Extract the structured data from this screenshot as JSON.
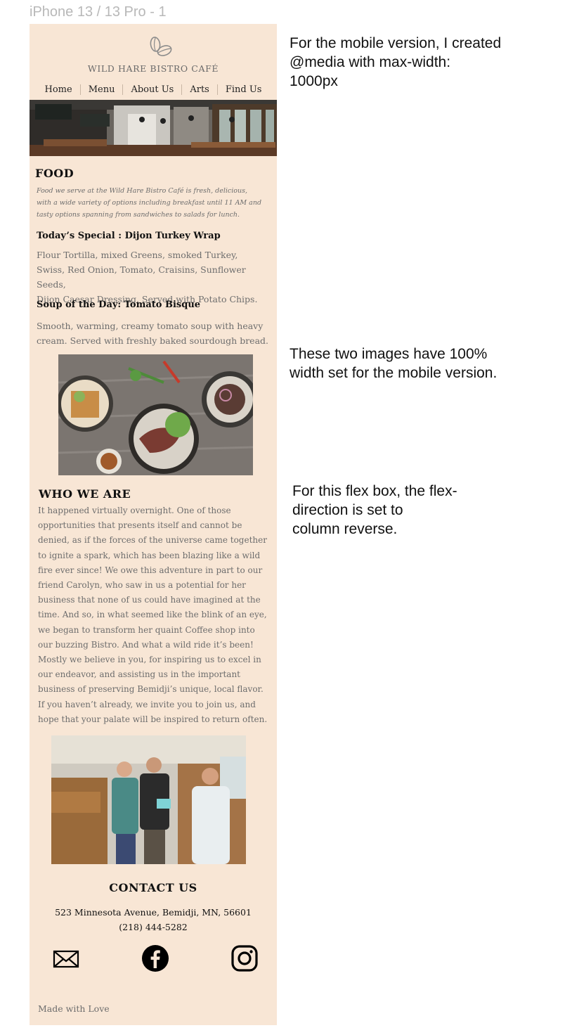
{
  "frame_label": "iPhone 13 / 13 Pro - 1",
  "notes": {
    "media": [
      "For the mobile version, I created",
      "@media with max-width:",
      "1000px"
    ],
    "images": [
      "These two images have 100%",
      "width set for the mobile version."
    ],
    "flex": [
      "For this flex box, the flex-",
      "direction is set to",
      "column reverse."
    ]
  },
  "site": {
    "brand": "WILD HARE BISTRO CAFÉ",
    "nav": [
      "Home",
      "Menu",
      "About Us",
      "Arts",
      "Find Us"
    ],
    "food": {
      "heading": "FOOD",
      "description": [
        "Food we serve at the Wild Hare Bistro Café is fresh, delicious,",
        "with a wide variety of options including breakfast until 11 AM and",
        "tasty options spanning from sandwiches to salads for lunch."
      ],
      "special_title": "Today’s Special : Dijon Turkey Wrap",
      "special_body": [
        "Flour Tortilla, mixed Greens, smoked Turkey,",
        "Swiss, Red Onion, Tomato, Craisins, Sunflower Seeds,",
        "Dijon Caesar Dressing. Served with Potato Chips."
      ],
      "soup_title": "Soup of the Day: Tomato Bisque",
      "soup_body": [
        "Smooth, warming, creamy tomato soup with heavy",
        "cream. Served with freshly baked sourdough bread."
      ]
    },
    "who": {
      "heading": "WHO WE ARE",
      "body": [
        "It happened virtually overnight. One of those",
        "opportunities that presents itself and cannot be",
        "denied, as if the forces of the universe came together",
        "to ignite a spark, which has been blazing like a wild",
        "fire ever since! We owe this adventure in part to our",
        "friend Carolyn, who saw in us a potential for her",
        "business that none of us could have imagined at the",
        "time. And so, in what seemed like the blink of an eye,",
        "we began to transform her quaint Coffee shop into",
        "our buzzing Bistro. And what a wild ride it’s been!",
        "Mostly we believe in you, for inspiring us to excel in",
        "our endeavor, and assisting us in the important",
        "business of preserving Bemidji’s unique, local flavor.",
        "If you haven’t already, we invite you to join us, and",
        "hope that your palate will be inspired to return often."
      ]
    },
    "contact": {
      "heading": "CONTACT US",
      "address": "523 Minnesota Avenue, Bemidji, MN, 56601",
      "phone": "(218) 444-5282"
    },
    "social_icons": [
      "mail-icon",
      "facebook-icon",
      "instagram-icon"
    ],
    "footer": "Made with Love"
  },
  "colors": {
    "page_bg": "#f8e6d5",
    "muted_text": "#6d6d6d",
    "heading": "#111111"
  }
}
